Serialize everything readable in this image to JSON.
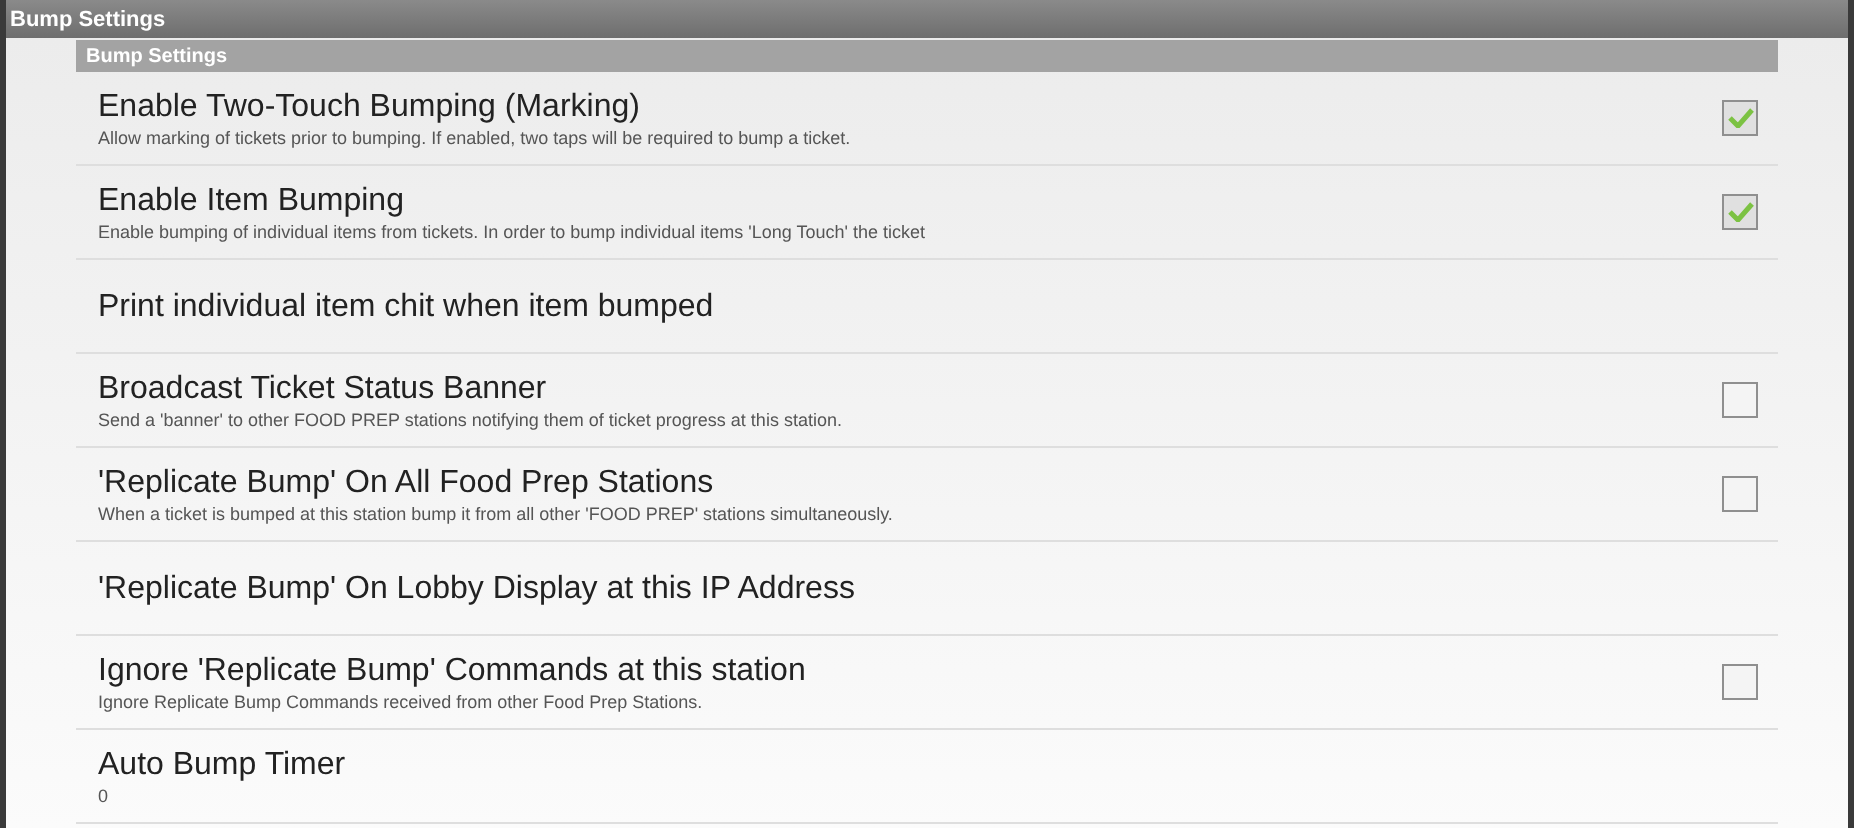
{
  "window": {
    "title": "Bump Settings"
  },
  "section": {
    "title": "Bump Settings"
  },
  "settings": [
    {
      "kind": "checkbox",
      "title": "Enable Two-Touch Bumping (Marking)",
      "summary": "Allow marking of tickets prior to bumping. If enabled, two taps will be required to bump a ticket.",
      "checked": true
    },
    {
      "kind": "checkbox",
      "title": "Enable Item Bumping",
      "summary": "Enable bumping of individual items from tickets. In order to bump individual items 'Long Touch' the ticket",
      "checked": true
    },
    {
      "kind": "plain",
      "title": "Print individual item chit when item bumped"
    },
    {
      "kind": "checkbox",
      "title": "Broadcast Ticket Status Banner",
      "summary": "Send a 'banner' to other FOOD PREP stations notifying them of ticket progress at this station.",
      "checked": false
    },
    {
      "kind": "checkbox",
      "title": "'Replicate Bump' On All Food Prep Stations",
      "summary": "When a ticket is bumped at this station bump it from all other 'FOOD PREP' stations simultaneously.",
      "checked": false
    },
    {
      "kind": "plain",
      "title": "'Replicate Bump' On Lobby Display at this IP Address"
    },
    {
      "kind": "checkbox",
      "title": "Ignore 'Replicate Bump' Commands at this station",
      "summary": "Ignore Replicate Bump Commands received from other Food Prep Stations.",
      "checked": false
    },
    {
      "kind": "plain",
      "title": "Auto Bump Timer",
      "summary": "0"
    }
  ]
}
